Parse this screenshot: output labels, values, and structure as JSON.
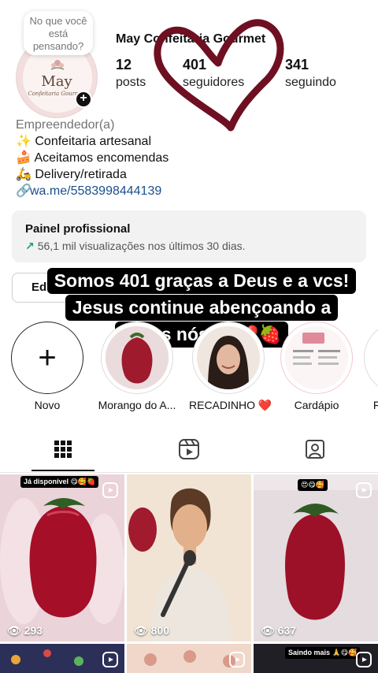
{
  "note": {
    "text": "No que você está pensando?"
  },
  "profile": {
    "name": "May Confeitaria Gourmet",
    "posts_count": "12",
    "posts_label": "posts",
    "followers_count": "401",
    "followers_label": "seguidores",
    "following_count": "341",
    "following_label": "seguindo",
    "avatar_logo_name": "May",
    "avatar_logo_sub": "Confeitaria Gourmet"
  },
  "bio": {
    "category": "Empreendedor(a)",
    "line1": "✨ Confeitaria artesanal",
    "line2": "🍰 Aceitamos encomendas",
    "line3": "🛵 Delivery/retirada",
    "link": "wa.me/5583998444139"
  },
  "pro_panel": {
    "title": "Painel profissional",
    "subtitle": "56,1 mil visualizações nos últimos 30 dias."
  },
  "edit_button": {
    "label": "Ed"
  },
  "caption": {
    "line1": "Somos 401 graças a Deus e a vcs!",
    "line2": "Jesus continue abençoando a",
    "line3": "todos nós 🙏❤️🍓"
  },
  "highlights": [
    {
      "label": "Novo"
    },
    {
      "label": "Morango do A..."
    },
    {
      "label": "RECADINHO ❤️"
    },
    {
      "label": "Cardápio"
    },
    {
      "label": "Fe"
    }
  ],
  "tabs": [
    {
      "icon": "grid-icon"
    },
    {
      "icon": "reels-icon"
    },
    {
      "icon": "tagged-icon"
    }
  ],
  "grid": [
    {
      "views": "293",
      "tag": "Já disponível 😋🥰🍓"
    },
    {
      "views": "800"
    },
    {
      "views": "637",
      "tag": "😍😋🥰"
    },
    {
      "tag": ""
    },
    {
      "tag": ""
    },
    {
      "tag": "Saindo mais 🙏😋🥰"
    }
  ],
  "colors": {
    "heart_stroke": "#6e0f22",
    "link": "#1a4f8b",
    "pro_arrow": "#1aa06d",
    "strawberry": "#b0132b"
  }
}
